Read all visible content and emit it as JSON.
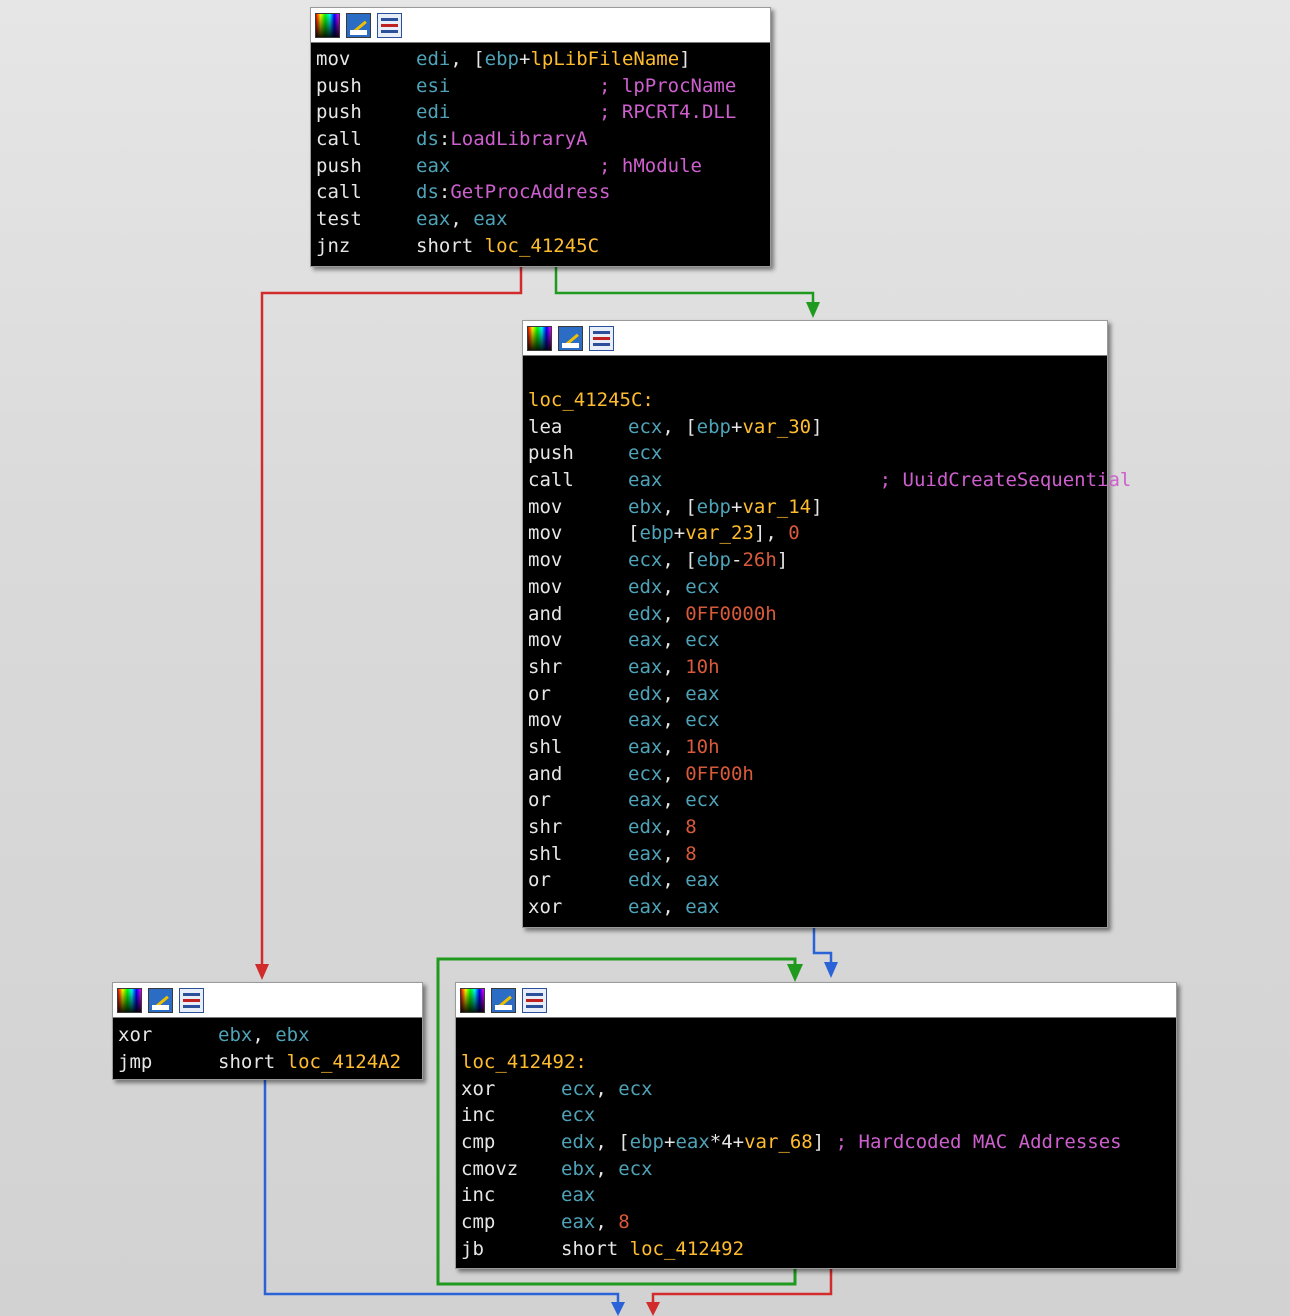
{
  "colors": {
    "false_edge": "#d12b2b",
    "true_edge": "#1f9a1f",
    "flow_edge": "#2a62d8",
    "register": "#4fa3b8",
    "symbol": "#ffbd2e",
    "comment": "#ce5fce",
    "number": "#d85a3a"
  },
  "header_icons": [
    "color-palette-icon",
    "rename-icon",
    "graph-overview-icon"
  ],
  "blocks": [
    {
      "id": "block-1",
      "lines": [
        {
          "mn": "mov",
          "ops": [
            {
              "t": "edi",
              "k": "r"
            },
            {
              "t": ", [",
              "k": "p"
            },
            {
              "t": "ebp",
              "k": "r"
            },
            {
              "t": "+",
              "k": "p"
            },
            {
              "t": "lpLibFileName",
              "k": "y"
            },
            {
              "t": "]",
              "k": "p"
            }
          ]
        },
        {
          "mn": "push",
          "ops": [
            {
              "t": "esi",
              "k": "r"
            },
            {
              "t": "             ; lpProcName",
              "k": "c"
            }
          ]
        },
        {
          "mn": "push",
          "ops": [
            {
              "t": "edi",
              "k": "r"
            },
            {
              "t": "             ; RPCRT4.DLL",
              "k": "c"
            }
          ]
        },
        {
          "mn": "call",
          "ops": [
            {
              "t": "ds",
              "k": "r"
            },
            {
              "t": ":",
              "k": "p"
            },
            {
              "t": "LoadLibraryA",
              "k": "c"
            }
          ]
        },
        {
          "mn": "push",
          "ops": [
            {
              "t": "eax",
              "k": "r"
            },
            {
              "t": "             ; hModule",
              "k": "c"
            }
          ]
        },
        {
          "mn": "call",
          "ops": [
            {
              "t": "ds",
              "k": "r"
            },
            {
              "t": ":",
              "k": "p"
            },
            {
              "t": "GetProcAddress",
              "k": "c"
            }
          ]
        },
        {
          "mn": "test",
          "ops": [
            {
              "t": "eax",
              "k": "r"
            },
            {
              "t": ", ",
              "k": "p"
            },
            {
              "t": "eax",
              "k": "r"
            }
          ]
        },
        {
          "mn": "jnz",
          "ops": [
            {
              "t": "short ",
              "k": "p"
            },
            {
              "t": "loc_41245C",
              "k": "y"
            }
          ]
        }
      ]
    },
    {
      "id": "block-2",
      "label": "loc_41245C:",
      "lines": [
        {
          "mn": "lea",
          "ops": [
            {
              "t": "ecx",
              "k": "r"
            },
            {
              "t": ", [",
              "k": "p"
            },
            {
              "t": "ebp",
              "k": "r"
            },
            {
              "t": "+",
              "k": "p"
            },
            {
              "t": "var_30",
              "k": "y"
            },
            {
              "t": "]",
              "k": "p"
            }
          ]
        },
        {
          "mn": "push",
          "ops": [
            {
              "t": "ecx",
              "k": "r"
            }
          ]
        },
        {
          "mn": "call",
          "ops": [
            {
              "t": "eax",
              "k": "r"
            },
            {
              "t": "                   ; UuidCreateSequential",
              "k": "c"
            }
          ]
        },
        {
          "mn": "mov",
          "ops": [
            {
              "t": "ebx",
              "k": "r"
            },
            {
              "t": ", [",
              "k": "p"
            },
            {
              "t": "ebp",
              "k": "r"
            },
            {
              "t": "+",
              "k": "p"
            },
            {
              "t": "var_14",
              "k": "y"
            },
            {
              "t": "]",
              "k": "p"
            }
          ]
        },
        {
          "mn": "mov",
          "ops": [
            {
              "t": "[",
              "k": "p"
            },
            {
              "t": "ebp",
              "k": "r"
            },
            {
              "t": "+",
              "k": "p"
            },
            {
              "t": "var_23",
              "k": "y"
            },
            {
              "t": "], ",
              "k": "p"
            },
            {
              "t": "0",
              "k": "n"
            }
          ]
        },
        {
          "mn": "mov",
          "ops": [
            {
              "t": "ecx",
              "k": "r"
            },
            {
              "t": ", [",
              "k": "p"
            },
            {
              "t": "ebp",
              "k": "r"
            },
            {
              "t": "-",
              "k": "p"
            },
            {
              "t": "26h",
              "k": "n"
            },
            {
              "t": "]",
              "k": "p"
            }
          ]
        },
        {
          "mn": "mov",
          "ops": [
            {
              "t": "edx",
              "k": "r"
            },
            {
              "t": ", ",
              "k": "p"
            },
            {
              "t": "ecx",
              "k": "r"
            }
          ]
        },
        {
          "mn": "and",
          "ops": [
            {
              "t": "edx",
              "k": "r"
            },
            {
              "t": ", ",
              "k": "p"
            },
            {
              "t": "0FF0000h",
              "k": "n"
            }
          ]
        },
        {
          "mn": "mov",
          "ops": [
            {
              "t": "eax",
              "k": "r"
            },
            {
              "t": ", ",
              "k": "p"
            },
            {
              "t": "ecx",
              "k": "r"
            }
          ]
        },
        {
          "mn": "shr",
          "ops": [
            {
              "t": "eax",
              "k": "r"
            },
            {
              "t": ", ",
              "k": "p"
            },
            {
              "t": "10h",
              "k": "n"
            }
          ]
        },
        {
          "mn": "or",
          "ops": [
            {
              "t": "edx",
              "k": "r"
            },
            {
              "t": ", ",
              "k": "p"
            },
            {
              "t": "eax",
              "k": "r"
            }
          ]
        },
        {
          "mn": "mov",
          "ops": [
            {
              "t": "eax",
              "k": "r"
            },
            {
              "t": ", ",
              "k": "p"
            },
            {
              "t": "ecx",
              "k": "r"
            }
          ]
        },
        {
          "mn": "shl",
          "ops": [
            {
              "t": "eax",
              "k": "r"
            },
            {
              "t": ", ",
              "k": "p"
            },
            {
              "t": "10h",
              "k": "n"
            }
          ]
        },
        {
          "mn": "and",
          "ops": [
            {
              "t": "ecx",
              "k": "r"
            },
            {
              "t": ", ",
              "k": "p"
            },
            {
              "t": "0FF00h",
              "k": "n"
            }
          ]
        },
        {
          "mn": "or",
          "ops": [
            {
              "t": "eax",
              "k": "r"
            },
            {
              "t": ", ",
              "k": "p"
            },
            {
              "t": "ecx",
              "k": "r"
            }
          ]
        },
        {
          "mn": "shr",
          "ops": [
            {
              "t": "edx",
              "k": "r"
            },
            {
              "t": ", ",
              "k": "p"
            },
            {
              "t": "8",
              "k": "n"
            }
          ]
        },
        {
          "mn": "shl",
          "ops": [
            {
              "t": "eax",
              "k": "r"
            },
            {
              "t": ", ",
              "k": "p"
            },
            {
              "t": "8",
              "k": "n"
            }
          ]
        },
        {
          "mn": "or",
          "ops": [
            {
              "t": "edx",
              "k": "r"
            },
            {
              "t": ", ",
              "k": "p"
            },
            {
              "t": "eax",
              "k": "r"
            }
          ]
        },
        {
          "mn": "xor",
          "ops": [
            {
              "t": "eax",
              "k": "r"
            },
            {
              "t": ", ",
              "k": "p"
            },
            {
              "t": "eax",
              "k": "r"
            }
          ]
        }
      ]
    },
    {
      "id": "block-3",
      "lines": [
        {
          "mn": "xor",
          "ops": [
            {
              "t": "ebx",
              "k": "r"
            },
            {
              "t": ", ",
              "k": "p"
            },
            {
              "t": "ebx",
              "k": "r"
            }
          ]
        },
        {
          "mn": "jmp",
          "ops": [
            {
              "t": "short ",
              "k": "p"
            },
            {
              "t": "loc_4124A2",
              "k": "y"
            }
          ]
        }
      ]
    },
    {
      "id": "block-4",
      "label": "loc_412492:",
      "lines": [
        {
          "mn": "xor",
          "ops": [
            {
              "t": "ecx",
              "k": "r"
            },
            {
              "t": ", ",
              "k": "p"
            },
            {
              "t": "ecx",
              "k": "r"
            }
          ]
        },
        {
          "mn": "inc",
          "ops": [
            {
              "t": "ecx",
              "k": "r"
            }
          ]
        },
        {
          "mn": "cmp",
          "ops": [
            {
              "t": "edx",
              "k": "r"
            },
            {
              "t": ", [",
              "k": "p"
            },
            {
              "t": "ebp",
              "k": "r"
            },
            {
              "t": "+",
              "k": "p"
            },
            {
              "t": "eax",
              "k": "r"
            },
            {
              "t": "*4+",
              "k": "p"
            },
            {
              "t": "var_68",
              "k": "y"
            },
            {
              "t": "] ",
              "k": "p"
            },
            {
              "t": "; Hardcoded MAC Addresses",
              "k": "c"
            }
          ]
        },
        {
          "mn": "cmovz",
          "ops": [
            {
              "t": "ebx",
              "k": "r"
            },
            {
              "t": ", ",
              "k": "p"
            },
            {
              "t": "ecx",
              "k": "r"
            }
          ]
        },
        {
          "mn": "inc",
          "ops": [
            {
              "t": "eax",
              "k": "r"
            }
          ]
        },
        {
          "mn": "cmp",
          "ops": [
            {
              "t": "eax",
              "k": "r"
            },
            {
              "t": ", ",
              "k": "p"
            },
            {
              "t": "8",
              "k": "n"
            }
          ]
        },
        {
          "mn": "jb",
          "ops": [
            {
              "t": "short ",
              "k": "p"
            },
            {
              "t": "loc_412492",
              "k": "y"
            }
          ]
        }
      ]
    }
  ]
}
